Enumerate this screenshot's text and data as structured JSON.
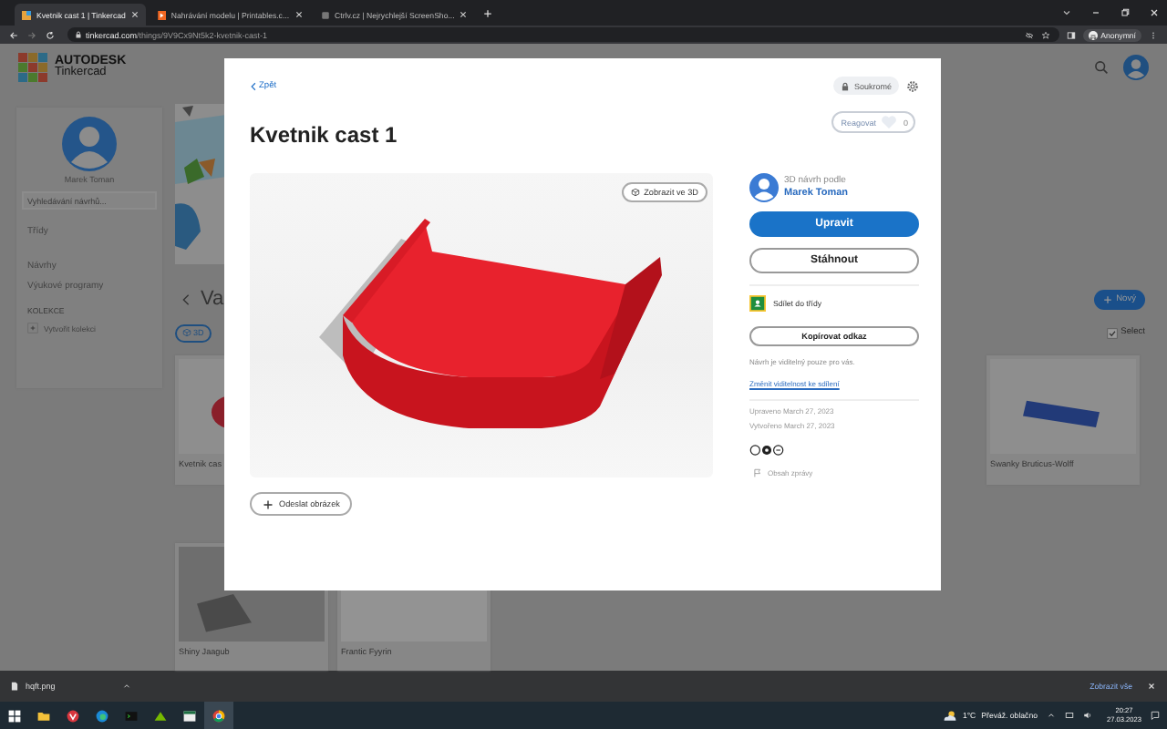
{
  "browser": {
    "tabs": [
      {
        "title": "Kvetnik cast 1 | Tinkercad",
        "selected": true,
        "kind": "tinkercad"
      },
      {
        "title": "Nahrávání modelu | Printables.c...",
        "selected": false,
        "kind": "printables"
      },
      {
        "title": "Ctrlv.cz | Nejrychlejší ScreenSho...",
        "selected": false,
        "kind": "ctrlv"
      }
    ],
    "url_host": "tinkercad.com",
    "url_path": "/things/9V9Cx9Nt5k2-kvetnik-cast-1",
    "profile": "Anonymní"
  },
  "header": {
    "brand": "AUTODESK",
    "product": "Tinkercad"
  },
  "sidebar": {
    "user": "Marek Toman",
    "search_placeholder": "Vyhledávání návrhů...",
    "items": [
      "Třídy",
      "Návrhy",
      "Výukové programy"
    ],
    "section": "KOLEKCE",
    "create": "Vytvořit kolekci"
  },
  "gallery": {
    "heading": "Va",
    "filter": "3D",
    "new_button": "Nový",
    "select": "Select",
    "select_checked": true,
    "cards": [
      {
        "title": "Kvetnik cas",
        "kind": "planter"
      },
      {
        "title": "Swanky Bruticus-Wolff",
        "kind": "bar"
      },
      {
        "title": "Shiny Jaagub",
        "kind": "gray"
      },
      {
        "title": "Frantic Fyyrin",
        "kind": "plain"
      }
    ]
  },
  "modal": {
    "back": "Zpět",
    "privacy": "Soukromé",
    "title": "Kvetnik cast 1",
    "view_3d": "Zobrazit ve 3D",
    "upload": "Odeslat obrázek",
    "react": "Reagovat",
    "likes": "0",
    "design_by": "3D návrh podle",
    "author": "Marek Toman",
    "edit": "Upravit",
    "download": "Stáhnout",
    "share_class": "Sdílet do třídy",
    "copy_link": "Kopírovat odkaz",
    "visibility_note": "Návrh je viditelný pouze pro vás.",
    "change_visibility": "Změnit viditelnost ke sdílení",
    "modified": "Upraveno March 27, 2023",
    "created": "Vytvořeno March 27, 2023",
    "report": "Obsah zprávy"
  },
  "downloads": {
    "file": "hqft.png",
    "show_all": "Zobrazit vše"
  },
  "taskbar": {
    "temperature": "1°C",
    "weather": "Převáž. oblačno",
    "time": "20:27",
    "date": "27.03.2023"
  }
}
